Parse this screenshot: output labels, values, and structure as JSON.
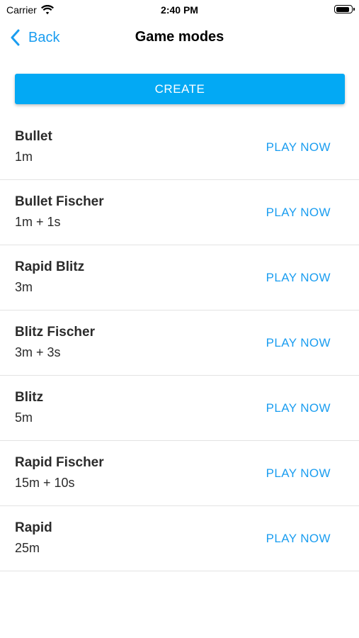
{
  "status_bar": {
    "carrier": "Carrier",
    "time": "2:40 PM",
    "battery_level": 0.9
  },
  "nav": {
    "back_label": "Back",
    "title": "Game modes"
  },
  "create_label": "CREATE",
  "modes": [
    {
      "name": "Bullet",
      "time": "1m",
      "action": "PLAY NOW"
    },
    {
      "name": "Bullet Fischer",
      "time": "1m + 1s",
      "action": "PLAY NOW"
    },
    {
      "name": "Rapid Blitz",
      "time": "3m",
      "action": "PLAY NOW"
    },
    {
      "name": "Blitz Fischer",
      "time": "3m + 3s",
      "action": "PLAY NOW"
    },
    {
      "name": "Blitz",
      "time": "5m",
      "action": "PLAY NOW"
    },
    {
      "name": "Rapid Fischer",
      "time": "15m + 10s",
      "action": "PLAY NOW"
    },
    {
      "name": "Rapid",
      "time": "25m",
      "action": "PLAY NOW"
    }
  ],
  "colors": {
    "accent": "#03a9f4",
    "link": "#1a9df0",
    "divider": "#e3e3e3"
  }
}
